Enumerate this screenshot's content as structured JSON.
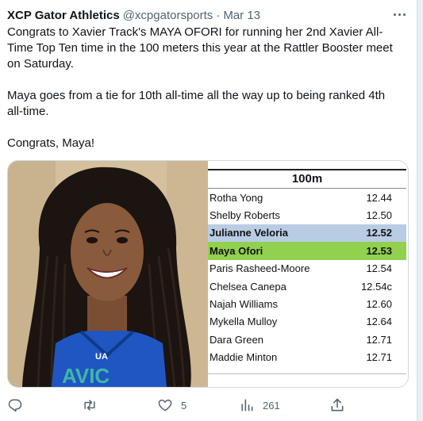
{
  "tweet": {
    "author": "XCP Gator Athletics",
    "handle": "@xcpgatorsports",
    "separator": "·",
    "date": "Mar 13",
    "paragraphs": [
      "Congrats to Xavier Track's MAYA OFORI for running her 2nd Xavier All-\nTime Top Ten time in the 100 meters this year at the Rattler Booster meet\non Saturday.",
      "Maya goes from a tie for 10th all-time all the way up to being ranked 4th\nall-time.",
      "Congrats, Maya!"
    ]
  },
  "image": {
    "alt": "Smiling athlete with long braids wearing a blue jersey",
    "jersey_text": "AVIC",
    "table": {
      "title": "100m",
      "rows": [
        {
          "name": "Rotha Yong",
          "time": "12.44",
          "highlight": "none"
        },
        {
          "name": "Shelby Roberts",
          "time": "12.50",
          "highlight": "none"
        },
        {
          "name": "Julianne Veloria",
          "time": "12.52",
          "highlight": "blue"
        },
        {
          "name": "Maya Ofori",
          "time": "12.53",
          "highlight": "green"
        },
        {
          "name": "Paris Rasheed-Moore",
          "time": "12.54",
          "highlight": "none"
        },
        {
          "name": "Chelsea Canepa",
          "time": "12.54c",
          "highlight": "none"
        },
        {
          "name": "Najah Williams",
          "time": "12.60",
          "highlight": "none"
        },
        {
          "name": "Mykella Mulloy",
          "time": "12.64",
          "highlight": "none"
        },
        {
          "name": "Dara Green",
          "time": "12.71",
          "highlight": "none"
        },
        {
          "name": "Maddie Minton",
          "time": "12.71",
          "highlight": "none"
        }
      ]
    }
  },
  "actions": {
    "reply": {
      "icon": "reply-icon",
      "count": ""
    },
    "retweet": {
      "icon": "retweet-icon",
      "count": ""
    },
    "like": {
      "icon": "heart-icon",
      "count": "5"
    },
    "views": {
      "icon": "views-icon",
      "count": "261"
    },
    "share": {
      "icon": "share-icon",
      "count": ""
    }
  },
  "colors": {
    "text": "#0f1419",
    "secondary": "#536471",
    "highlight_blue": "#b8cce4",
    "highlight_green": "#92d050",
    "jersey": "#1f56c2"
  }
}
